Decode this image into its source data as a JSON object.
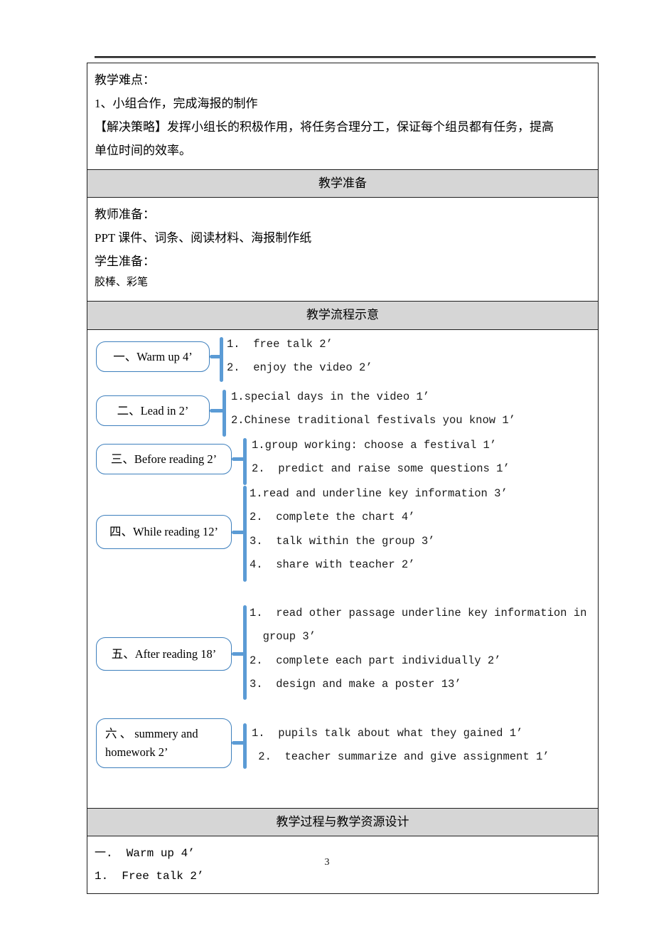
{
  "page": {
    "page_number": "3"
  },
  "difficulty_block": {
    "line1": "教学难点：",
    "line2": "1、小组合作，完成海报的制作",
    "line3": "【解决策略】发挥小组长的积极作用，将任务合理分工，保证每个组员都有任务，提高",
    "line4": "单位时间的效率。"
  },
  "prep_section": {
    "header": "教学准备",
    "teacher_label": "教师准备：",
    "teacher_items": "PPT 课件、词条、阅读材料、海报制作纸",
    "student_label": "学生准备：",
    "student_items": "胶棒、彩笔"
  },
  "flow_section": {
    "header": "教学流程示意",
    "steps": [
      {
        "box_label": "一、Warm up 4’",
        "items": [
          "1.  free talk 2’",
          "2.  enjoy the video 2’"
        ]
      },
      {
        "box_label": "二、Lead in 2’",
        "items": [
          "1.special days in the video 1’",
          "2.Chinese traditional festivals you know 1’"
        ]
      },
      {
        "box_label": "三、Before reading 2’",
        "items": [
          "1.group working: choose a festival 1’",
          "2.  predict and raise some questions 1’"
        ]
      },
      {
        "box_label": "四、While reading 12’",
        "items": [
          "1.read and underline key information 3’",
          "2.  complete the chart 4’",
          "3.  talk within the group 3’",
          "4.  share with teacher 2’"
        ]
      },
      {
        "box_label": "五、After reading 18’",
        "items": [
          "1.  read other passage underline key information in",
          "  group 3’",
          "2.  complete each part individually 2’",
          "3.  design and make a poster 13’"
        ]
      },
      {
        "box_label_line1": "六 、  summery  and",
        "box_label_line2": "homework 2’",
        "items": [
          "1.  pupils talk about what they gained 1’",
          " 2.  teacher summarize and give assignment 1’"
        ]
      }
    ]
  },
  "process_section": {
    "header": "教学过程与教学资源设计",
    "line1": "一.  Warm up 4’",
    "line2": "1.  Free talk 2’"
  },
  "colors": {
    "accent_blue": "#5b9bd5",
    "box_border_blue": "#3d7fbd",
    "header_grey": "#d6d6d6",
    "table_border": "#1e1e1e"
  }
}
